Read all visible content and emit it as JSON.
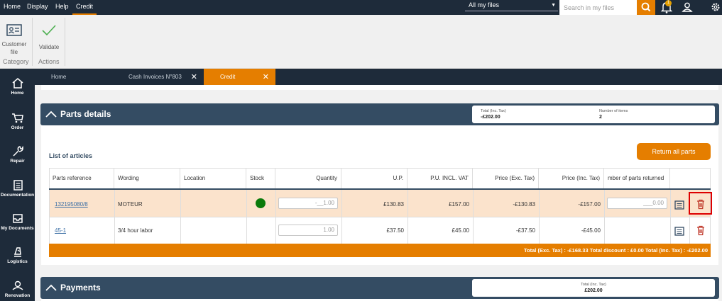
{
  "menu": {
    "items": [
      "Home",
      "Display",
      "Help",
      "Credit"
    ]
  },
  "topbar": {
    "file_filter": "All my files",
    "search_placeholder": "Search in my files",
    "notification_count": "1"
  },
  "ribbon": {
    "customer_file": "Customer file",
    "category": "Category",
    "validate": "Validate",
    "actions": "Actions"
  },
  "sidebar": {
    "items": [
      "Home",
      "Order",
      "Repair",
      "Documentation",
      "My Documents",
      "Logistics",
      "Renovation"
    ]
  },
  "tabs": [
    "Home",
    "Cash Invoices N°803",
    "Credit"
  ],
  "parts": {
    "title": "Parts details",
    "total_label": "Total (Inc. Tax)",
    "total_value": "-£202.00",
    "items_label": "Number of items",
    "items_value": "2",
    "list_title": "List of articles",
    "return_all": "Return all parts",
    "columns": [
      "Parts reference",
      "Wording",
      "Location",
      "Stock",
      "Quantity",
      "U.P.",
      "P.U. INCL. VAT",
      "Price (Exc. Tax)",
      "Price (Inc. Tax)",
      "mber of parts returned"
    ],
    "rows": [
      {
        "ref": "132195080/8",
        "wording": "MOTEUR",
        "location": "",
        "quantity": "-__1.00",
        "up": "£130.83",
        "pu_vat": "£157.00",
        "price_exc": "-£130.83",
        "price_inc": "-£157.00",
        "returned": "___0.00"
      },
      {
        "ref": "45-1",
        "wording": "3/4 hour labor",
        "location": "",
        "quantity": "1.00",
        "up": "£37.50",
        "pu_vat": "£45.00",
        "price_exc": "-£37.50",
        "price_inc": "-£45.00",
        "returned": ""
      }
    ],
    "totals": "Total (Exc. Tax) : -£168.33   Total discount : £0.00   Total (Inc. Tax) : -£202.00"
  },
  "payments": {
    "title": "Payments",
    "total_label": "Total (Inc. Tax)",
    "total_value": "£202.00"
  },
  "colors": {
    "accent": "#e57e00",
    "dark": "#1e2b3a",
    "section": "#344c63",
    "stock_ok": "#0a7a0a",
    "delete": "#c0392b"
  }
}
